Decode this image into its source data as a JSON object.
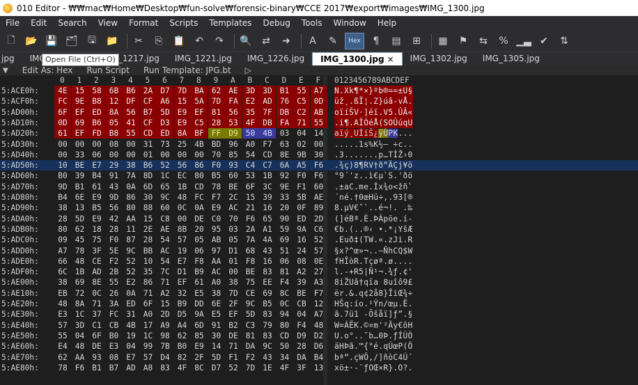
{
  "window": {
    "title": "010 Editor - ₩₩mac₩Home₩Desktop₩fun-solve₩forensic-binary₩CCE 2017₩export₩images₩IMG_1300.jpg"
  },
  "menu": [
    "File",
    "Edit",
    "Search",
    "View",
    "Format",
    "Scripts",
    "Templates",
    "Debug",
    "Tools",
    "Window",
    "Help"
  ],
  "toolbar": {
    "icons": [
      "new-file-icon",
      "open-file-icon",
      "save-icon",
      "save-all-icon",
      "save-as-icon",
      "open-folder-icon",
      "cut-icon",
      "copy-icon",
      "paste-icon",
      "undo-icon",
      "redo-icon",
      "find-icon",
      "replace-icon",
      "goto-icon",
      "font-icon",
      "highlight-icon",
      "hex-mode-icon",
      "paragraph-icon",
      "ruler-icon",
      "binary-icon",
      "calculator-icon",
      "template-run-icon",
      "script-run-icon",
      "percent-icon",
      "histogram-icon",
      "check-icon",
      "compare-icon"
    ],
    "hex_label": "Hex"
  },
  "tooltip": "Open File (Ctrl+O)",
  "tabs": [
    {
      "label": "jpg",
      "active": false
    },
    {
      "label": "IMG_1215.jpg",
      "active": false
    },
    {
      "label": "IMG_1217.jpg",
      "active": false
    },
    {
      "label": "IMG_1221.jpg",
      "active": false
    },
    {
      "label": "IMG_1226.jpg",
      "active": false
    },
    {
      "label": "IMG_1300.jpg",
      "active": true
    },
    {
      "label": "IMG_1302.jpg",
      "active": false
    },
    {
      "label": "IMG_1305.jpg",
      "active": false
    }
  ],
  "tab_close": "×",
  "editbar": {
    "edit_as": "Edit As: Hex",
    "run_script": "Run Script",
    "run_template": "Run Template: JPG.bt"
  },
  "hex_header": {
    "columns": "0 1 2 3 4 5 6 7 8 9 A B C D E F",
    "ascii": "0123456789ABCDEF"
  },
  "rows": [
    {
      "addr": "5:ACE0h:",
      "bytes": [
        "4E",
        "15",
        "58",
        "6B",
        "B6",
        "2A",
        "D7",
        "7D",
        "BA",
        "62",
        "AE",
        "3D",
        "3D",
        "B1",
        "55",
        "A7"
      ],
      "ascii": "N.Xk¶*×}ºb®==±U§"
    },
    {
      "addr": "5:ACF0h:",
      "bytes": [
        "FC",
        "9E",
        "B8",
        "12",
        "DF",
        "CF",
        "A6",
        "15",
        "5A",
        "7D",
        "FA",
        "E2",
        "AD",
        "76",
        "C5",
        "0D"
      ],
      "ascii": "üž¸.ßÏ¦.Z}úâ-vÅ."
    },
    {
      "addr": "5:AD00h:",
      "bytes": [
        "6F",
        "EF",
        "ED",
        "8A",
        "56",
        "B7",
        "5D",
        "E9",
        "EF",
        "81",
        "56",
        "35",
        "7F",
        "DB",
        "C2",
        "AB"
      ],
      "ascii": "oïíŠV·]éï.V5.ÛÂ«"
    },
    {
      "addr": "5:AD10h:",
      "bytes": [
        "0D",
        "69",
        "B6",
        "05",
        "41",
        "CF",
        "D3",
        "E9",
        "C5",
        "28",
        "53",
        "4F",
        "DB",
        "FA",
        "71",
        "55"
      ],
      "ascii": ".i¶.AÏÓéÅ(SOÛúqU"
    },
    {
      "addr": "5:AD20h:",
      "bytes": [
        "61",
        "EF",
        "FD",
        "B8",
        "55",
        "CD",
        "ED",
        "8A",
        "BF",
        "FF",
        "D9",
        "50",
        "4B",
        "03",
        "04",
        "14"
      ],
      "ascii": "aïý¸UÍíŠ¿ÿÙPK..."
    },
    {
      "addr": "5:AD30h:",
      "bytes": [
        "00",
        "00",
        "00",
        "08",
        "00",
        "31",
        "73",
        "25",
        "4B",
        "BD",
        "96",
        "A0",
        "F7",
        "63",
        "02",
        "00"
      ],
      "ascii": ".....1s%K½– ÷c.."
    },
    {
      "addr": "5:AD40h:",
      "bytes": [
        "00",
        "33",
        "06",
        "00",
        "00",
        "01",
        "00",
        "00",
        "00",
        "70",
        "85",
        "54",
        "CD",
        "8E",
        "9B",
        "30"
      ],
      "ascii": ".3.......p…TÍŽ›0"
    },
    {
      "addr": "5:AD50h:",
      "bytes": [
        "10",
        "BE",
        "E7",
        "29",
        "38",
        "B6",
        "52",
        "56",
        "86",
        "F0",
        "93",
        "C4",
        "C7",
        "6A",
        "A5",
        "F6"
      ],
      "ascii": ".¾ç)8¶RV†ð“ÄÇj¥ö"
    },
    {
      "addr": "5:AD60h:",
      "bytes": [
        "B0",
        "39",
        "B4",
        "91",
        "7A",
        "8D",
        "1C",
        "EC",
        "80",
        "B5",
        "60",
        "53",
        "1B",
        "92",
        "F0",
        "F6"
      ],
      "ascii": "°9´'z..ì€µ`S.'ðö"
    },
    {
      "addr": "5:AD70h:",
      "bytes": [
        "9D",
        "B1",
        "61",
        "43",
        "0A",
        "6D",
        "65",
        "1B",
        "CD",
        "78",
        "BE",
        "6F",
        "3C",
        "9E",
        "F1",
        "60"
      ],
      "ascii": ".±aC.me.Íx¾o<žñ`"
    },
    {
      "addr": "5:AD80h:",
      "bytes": [
        "B4",
        "6E",
        "E9",
        "9D",
        "86",
        "30",
        "9C",
        "48",
        "FC",
        "F7",
        "2C",
        "15",
        "39",
        "33",
        "5B",
        "AE"
      ],
      "ascii": "´né.†0œHü÷,.93[®"
    },
    {
      "addr": "5:AD90h:",
      "bytes": [
        "38",
        "13",
        "B5",
        "56",
        "80",
        "88",
        "60",
        "0C",
        "0A",
        "E9",
        "AC",
        "21",
        "16",
        "20",
        "0F",
        "89"
      ],
      "ascii": "8.µV€ˆ`..é¬!. .‰"
    },
    {
      "addr": "5:ADA0h:",
      "bytes": [
        "28",
        "5D",
        "E9",
        "42",
        "AA",
        "15",
        "C8",
        "00",
        "DE",
        "C0",
        "70",
        "F6",
        "65",
        "90",
        "ED",
        "2D"
      ],
      "ascii": "(]éBª.È.ÞÀpöe.í-"
    },
    {
      "addr": "5:ADB0h:",
      "bytes": [
        "80",
        "62",
        "18",
        "28",
        "11",
        "2E",
        "AE",
        "8B",
        "20",
        "95",
        "03",
        "2A",
        "A1",
        "59",
        "9A",
        "C6"
      ],
      "ascii": "€b.(..®‹ •.*¡YšÆ"
    },
    {
      "addr": "5:ADC0h:",
      "bytes": [
        "09",
        "45",
        "75",
        "F0",
        "87",
        "28",
        "54",
        "57",
        "05",
        "AB",
        "05",
        "7A",
        "4A",
        "69",
        "16",
        "52"
      ],
      "ascii": ".Euð‡(TW.«.zJi.R"
    },
    {
      "addr": "5:ADD0h:",
      "bytes": [
        "A7",
        "78",
        "3F",
        "5E",
        "9C",
        "BB",
        "AC",
        "19",
        "06",
        "97",
        "D1",
        "68",
        "43",
        "51",
        "24",
        "57"
      ],
      "ascii": "§x?^œ»¬..—ÑhCQ$W"
    },
    {
      "addr": "5:ADE0h:",
      "bytes": [
        "66",
        "48",
        "CE",
        "F2",
        "52",
        "10",
        "54",
        "E7",
        "F8",
        "AA",
        "01",
        "F8",
        "16",
        "06",
        "08",
        "0E"
      ],
      "ascii": "fHÎòR.Tçøª.ø...."
    },
    {
      "addr": "5:ADF0h:",
      "bytes": [
        "6C",
        "1B",
        "AD",
        "2B",
        "52",
        "35",
        "7C",
        "D1",
        "B9",
        "AC",
        "00",
        "BE",
        "83",
        "81",
        "A2",
        "27"
      ],
      "ascii": "l.-+R5|Ñ¹¬.¾ƒ.¢'"
    },
    {
      "addr": "5:AE00h:",
      "bytes": [
        "38",
        "69",
        "8E",
        "55",
        "E2",
        "86",
        "71",
        "EF",
        "61",
        "A0",
        "38",
        "75",
        "EE",
        "F4",
        "39",
        "A3"
      ],
      "ascii": "8iŽUâ†qïa 8uîô9£"
    },
    {
      "addr": "5:AE10h:",
      "bytes": [
        "EB",
        "72",
        "0C",
        "26",
        "0A",
        "71",
        "A2",
        "32",
        "E5",
        "38",
        "7D",
        "CE",
        "69",
        "8C",
        "BE",
        "F7"
      ],
      "ascii": "ër.&.q¢2å8}ÎiŒ¾÷"
    },
    {
      "addr": "5:AE20h:",
      "bytes": [
        "48",
        "8A",
        "71",
        "3A",
        "ED",
        "6F",
        "15",
        "B9",
        "DD",
        "6E",
        "2F",
        "9C",
        "B5",
        "0C",
        "CB",
        "12"
      ],
      "ascii": "HŠq:ío.¹Ýn/œµ.Ë."
    },
    {
      "addr": "5:AE30h:",
      "bytes": [
        "E3",
        "1C",
        "37",
        "FC",
        "31",
        "A0",
        "2D",
        "D5",
        "9A",
        "E5",
        "EF",
        "5D",
        "83",
        "94",
        "04",
        "A7"
      ],
      "ascii": "ã.7ü1 -Õšåï]ƒ”.§"
    },
    {
      "addr": "5:AE40h:",
      "bytes": [
        "57",
        "3D",
        "C1",
        "CB",
        "4B",
        "17",
        "A9",
        "A4",
        "6D",
        "91",
        "B2",
        "C3",
        "79",
        "80",
        "F4",
        "48"
      ],
      "ascii": "W=ÁËK.©¤m'²Ãy€ôH"
    },
    {
      "addr": "5:AE50h:",
      "bytes": [
        "55",
        "04",
        "6F",
        "B0",
        "19",
        "1C",
        "98",
        "62",
        "85",
        "30",
        "DE",
        "81",
        "83",
        "CD",
        "D9",
        "D2"
      ],
      "ascii": "U.o°..˜b…0Þ.ƒÍÙÒ"
    },
    {
      "addr": "5:AE60h:",
      "bytes": [
        "E4",
        "48",
        "DE",
        "E3",
        "04",
        "99",
        "7B",
        "B0",
        "E9",
        "14",
        "71",
        "DA",
        "9C",
        "50",
        "28",
        "D6"
      ],
      "ascii": "äHÞã.™{°é.qÚœP(Ö"
    },
    {
      "addr": "5:AE70h:",
      "bytes": [
        "62",
        "AA",
        "93",
        "08",
        "E7",
        "57",
        "D4",
        "82",
        "2F",
        "5D",
        "F1",
        "F2",
        "43",
        "34",
        "DA",
        "B4"
      ],
      "ascii": "bª“.çWÔ‚/]ñòC4Ú´"
    },
    {
      "addr": "5:AE80h:",
      "bytes": [
        "78",
        "F6",
        "B1",
        "B7",
        "AD",
        "A8",
        "83",
        "4F",
        "8C",
        "D7",
        "52",
        "7D",
        "1E",
        "4F",
        "3F",
        "13"
      ],
      "ascii": "xö±·-¨ƒOŒ×R}.O?."
    }
  ],
  "colors": {
    "red_region": "#8b0000",
    "eoi_marker": "#7a7a00",
    "pk_marker": "#3a3a9a",
    "cursor_row": "#16325c"
  }
}
